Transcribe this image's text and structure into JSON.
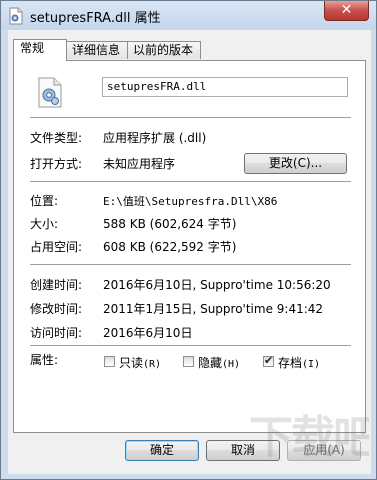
{
  "window": {
    "title": "setupresFRA.dll 属性",
    "close_glyph": "✕"
  },
  "tabs": [
    "常规",
    "详细信息",
    "以前的版本"
  ],
  "general": {
    "filename": "setupresFRA.dll",
    "file_type_label": "文件类型:",
    "file_type_value": "应用程序扩展 (.dll)",
    "open_with_label": "打开方式:",
    "open_with_value": "未知应用程序",
    "change_button": "更改(C)...",
    "location_label": "位置:",
    "location_value": "E:\\值班\\Setupresfra.Dll\\X86",
    "size_label": "大小:",
    "size_value": "588 KB (602,624 字节)",
    "disk_size_label": "占用空间:",
    "disk_size_value": "608 KB (622,592 字节)",
    "created_label": "创建时间:",
    "created_value": "2016年6月10日, Suppro'time 10:56:20",
    "modified_label": "修改时间:",
    "modified_value": "2011年1月15日, Suppro'time 9:41:42",
    "accessed_label": "访问时间:",
    "accessed_value": "2016年6月10日",
    "attributes_label": "属性:",
    "attributes": [
      {
        "label": "只读",
        "accel": "(R)",
        "checked": false
      },
      {
        "label": "隐藏",
        "accel": "(H)",
        "checked": false
      },
      {
        "label": "存档",
        "accel": "(I)",
        "checked": true
      }
    ]
  },
  "buttons": {
    "ok": "确定",
    "cancel": "取消",
    "apply": "应用(A)"
  },
  "colors": {
    "frame": "#cfdcec",
    "close": "#c75050"
  },
  "icons": {
    "title": "dll-file-icon",
    "file": "dll-gear-file-icon"
  },
  "watermark": "下载吧"
}
